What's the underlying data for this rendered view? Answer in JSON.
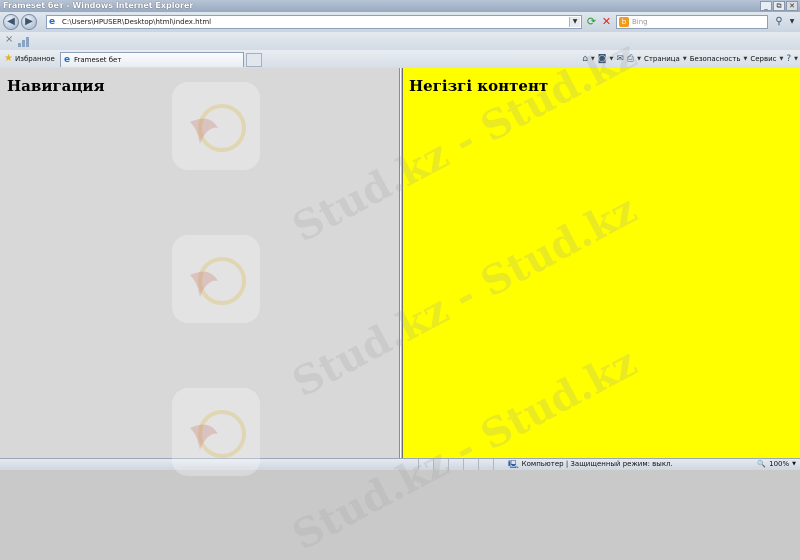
{
  "window": {
    "title": "Frameset бет - Windows Internet Explorer",
    "controls": {
      "minimize": "_",
      "restore": "⧉",
      "close": "✕"
    }
  },
  "address_bar": {
    "url": "C:\\Users\\HPUSER\\Desktop\\html\\index.html",
    "search_placeholder": "Bing"
  },
  "favorites_bar": {
    "favorites_label": "Избранное",
    "tab_title": "Frameset бет"
  },
  "toolbar": {
    "page_menu": "Страница",
    "security_menu": "Безопасность",
    "tools_menu": "Сервис"
  },
  "frames": {
    "left": {
      "heading": "Навигация",
      "background": "#d8d8d8"
    },
    "right": {
      "heading": "Негізгі контент",
      "background": "#ffff00"
    }
  },
  "status_bar": {
    "zone_text": "Компьютер | Защищенный режим: выкл.",
    "zoom": "100%"
  },
  "watermark": {
    "text": "Stud.kz - Stud.kz"
  },
  "icons": [
    "back-icon",
    "forward-icon",
    "page-icon",
    "refresh-icon",
    "stop-icon",
    "bing-icon",
    "search-icon",
    "favorites-star-icon",
    "ie-icon",
    "home-icon",
    "rss-icon",
    "mail-icon",
    "print-icon",
    "help-icon",
    "computer-icon",
    "zoom-icon"
  ]
}
